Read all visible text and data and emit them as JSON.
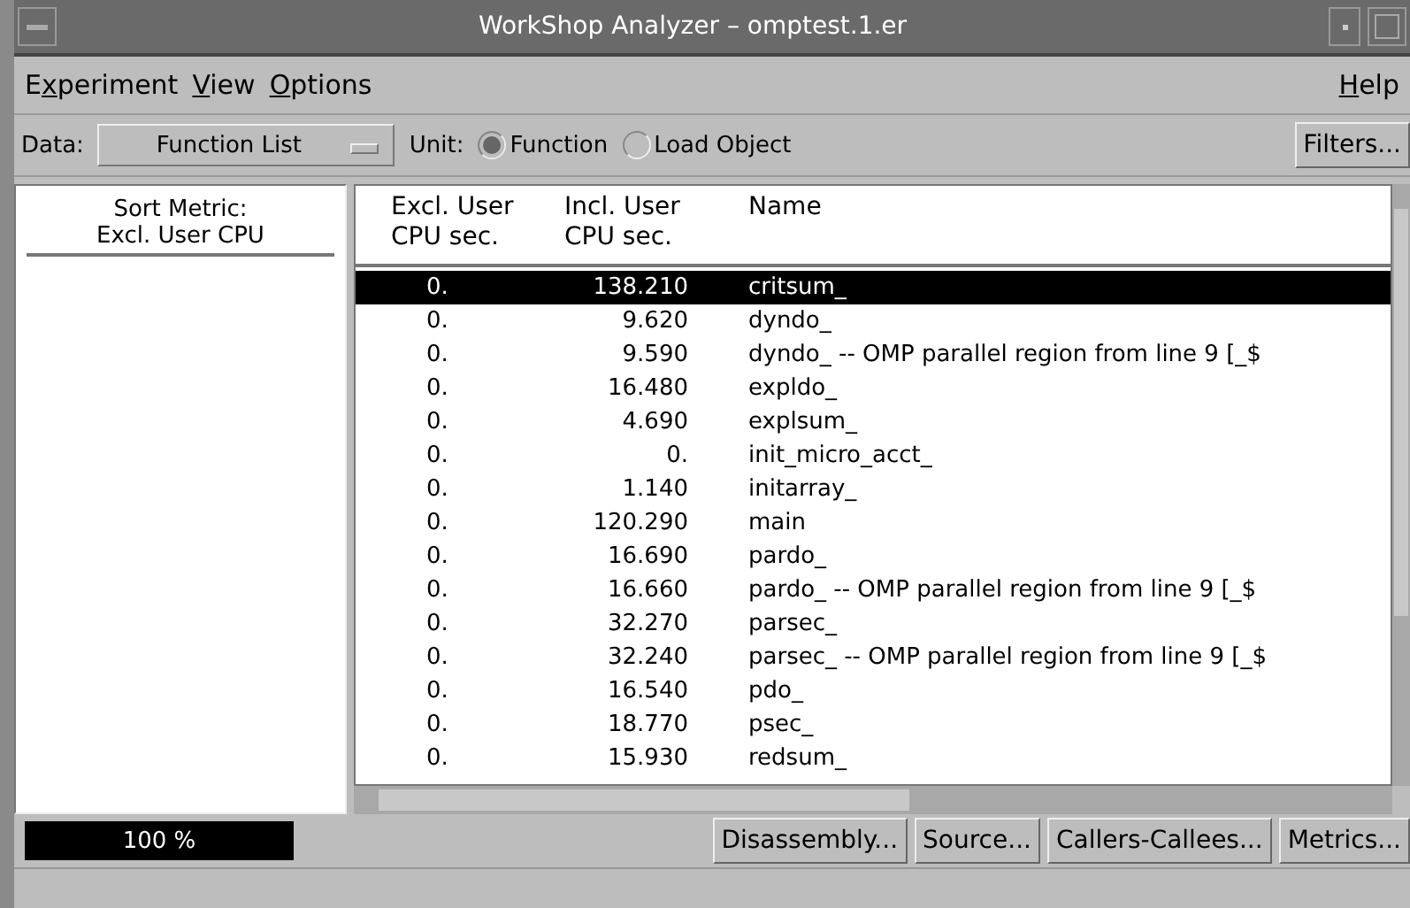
{
  "window": {
    "title": "WorkShop Analyzer – omptest.1.er"
  },
  "menu": [
    {
      "before": "E",
      "key": "x",
      "after": "periment"
    },
    {
      "key": "V",
      "after": "iew"
    },
    {
      "key": "O",
      "after": "ptions"
    }
  ],
  "help_menu": {
    "key": "H",
    "after": "elp"
  },
  "toolbar": {
    "data_label": "Data:",
    "data_value": "Function List",
    "unit_label": "Unit:",
    "units": [
      {
        "label": "Function",
        "selected": true
      },
      {
        "label": "Load Object",
        "selected": false
      }
    ],
    "filters_button": "Filters..."
  },
  "sort_metric": {
    "line1": "Sort Metric:",
    "line2": "Excl. User CPU"
  },
  "table": {
    "columns": [
      {
        "line1": "Excl. User",
        "line2": "CPU sec."
      },
      {
        "line1": "Incl. User",
        "line2": "CPU sec."
      },
      {
        "line1": "Name"
      }
    ],
    "rows": [
      {
        "excl": "0.",
        "incl": "138.210",
        "name": "critsum_",
        "selected": true
      },
      {
        "excl": "0.",
        "incl": "9.620",
        "name": "dyndo_",
        "selected": false
      },
      {
        "excl": "0.",
        "incl": "9.590",
        "name": "dyndo_ -- OMP parallel region from line 9 [_$",
        "selected": false
      },
      {
        "excl": "0.",
        "incl": "16.480",
        "name": "expldo_",
        "selected": false
      },
      {
        "excl": "0.",
        "incl": "4.690",
        "name": "explsum_",
        "selected": false
      },
      {
        "excl": "0.",
        "incl": "0.",
        "name": "init_micro_acct_",
        "selected": false
      },
      {
        "excl": "0.",
        "incl": "1.140",
        "name": "initarray_",
        "selected": false
      },
      {
        "excl": "0.",
        "incl": "120.290",
        "name": "main",
        "selected": false
      },
      {
        "excl": "0.",
        "incl": "16.690",
        "name": "pardo_",
        "selected": false
      },
      {
        "excl": "0.",
        "incl": "16.660",
        "name": "pardo_ -- OMP parallel region from line 9 [_$",
        "selected": false
      },
      {
        "excl": "0.",
        "incl": "32.270",
        "name": "parsec_",
        "selected": false
      },
      {
        "excl": "0.",
        "incl": "32.240",
        "name": "parsec_ -- OMP parallel region from line 9 [_$",
        "selected": false
      },
      {
        "excl": "0.",
        "incl": "16.540",
        "name": "pdo_",
        "selected": false
      },
      {
        "excl": "0.",
        "incl": "18.770",
        "name": "psec_",
        "selected": false
      },
      {
        "excl": "0.",
        "incl": "15.930",
        "name": "redsum_",
        "selected": false
      }
    ]
  },
  "progress": {
    "label": "100 %",
    "level": 1
  },
  "buttons": [
    "Disassembly...",
    "Source...",
    "Callers-Callees...",
    "Metrics..."
  ]
}
